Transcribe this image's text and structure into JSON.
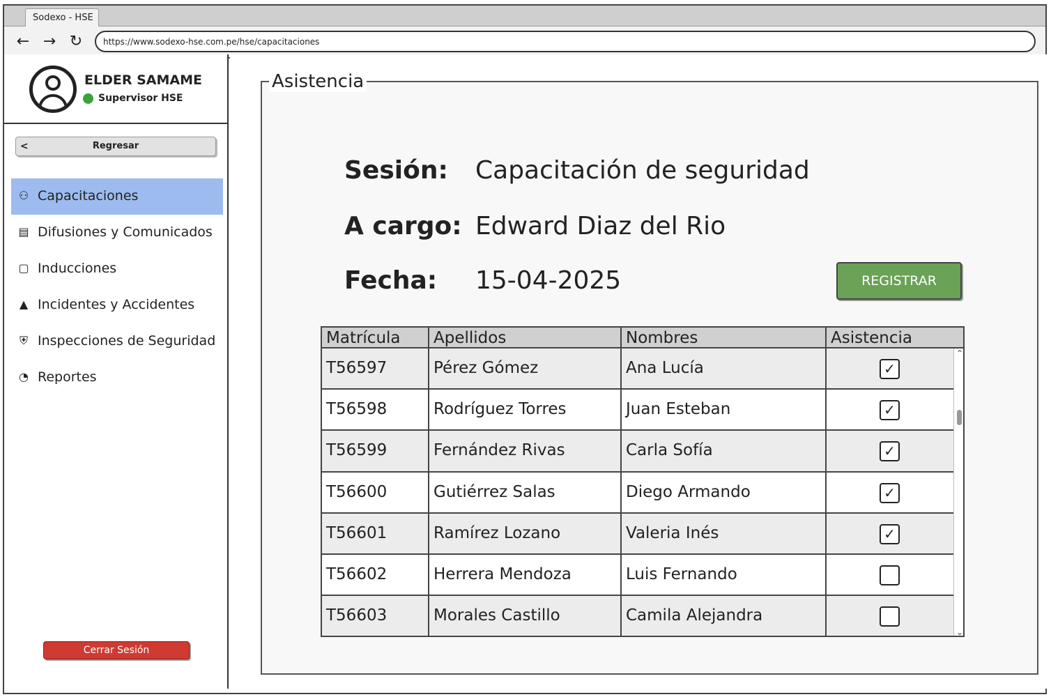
{
  "browser": {
    "tab_title": "Sodexo - HSE",
    "url": "https://www.sodexo-hse.com.pe/hse/capacitaciones",
    "nav": {
      "back_icon": "arrow-left-icon",
      "forward_icon": "arrow-right-icon",
      "reload_icon": "reload-icon"
    }
  },
  "sidebar": {
    "user": {
      "name": "ELDER SAMAME",
      "role": "Supervisor HSE",
      "status_color": "#3aa33a"
    },
    "back_label": "Regresar",
    "menu": [
      {
        "label": "Capacitaciones",
        "icon": "training-icon",
        "active": true
      },
      {
        "label": "Difusiones y Comunicados",
        "icon": "message-icon",
        "active": false
      },
      {
        "label": "Inducciones",
        "icon": "presentation-icon",
        "active": false
      },
      {
        "label": "Incidentes y Accidentes",
        "icon": "alarm-icon",
        "active": false
      },
      {
        "label": "Inspecciones de Seguridad",
        "icon": "shield-check-icon",
        "active": false
      },
      {
        "label": "Reportes",
        "icon": "pie-chart-icon",
        "active": false
      }
    ],
    "logout_label": "Cerrar Sesión",
    "active_color": "#9dbbee",
    "logout_color": "#cf3a33"
  },
  "main": {
    "section_title": "Asistencia",
    "session": {
      "label": "Sesión:",
      "value": "Capacitación de seguridad"
    },
    "in_charge": {
      "label": "A cargo:",
      "value": "Edward Diaz del Rio"
    },
    "date": {
      "label": "Fecha:",
      "value": "15-04-2025"
    },
    "register_label": "REGISTRAR",
    "register_color": "#6aa257",
    "table": {
      "columns": [
        "Matrícula",
        "Apellidos",
        "Nombres",
        "Asistencia"
      ],
      "rows": [
        {
          "id": "T56597",
          "last": "Pérez Gómez",
          "first": "Ana Lucía",
          "present": true
        },
        {
          "id": "T56598",
          "last": "Rodríguez Torres",
          "first": "Juan Esteban",
          "present": true
        },
        {
          "id": "T56599",
          "last": "Fernández Rivas",
          "first": "Carla Sofía",
          "present": true
        },
        {
          "id": "T56600",
          "last": "Gutiérrez Salas",
          "first": "Diego Armando",
          "present": true
        },
        {
          "id": "T56601",
          "last": "Ramírez Lozano",
          "first": "Valeria Inés",
          "present": true
        },
        {
          "id": "T56602",
          "last": "Herrera Mendoza",
          "first": "Luis Fernando",
          "present": false
        },
        {
          "id": "T56603",
          "last": "Morales Castillo",
          "first": "Camila Alejandra",
          "present": false
        }
      ]
    }
  }
}
